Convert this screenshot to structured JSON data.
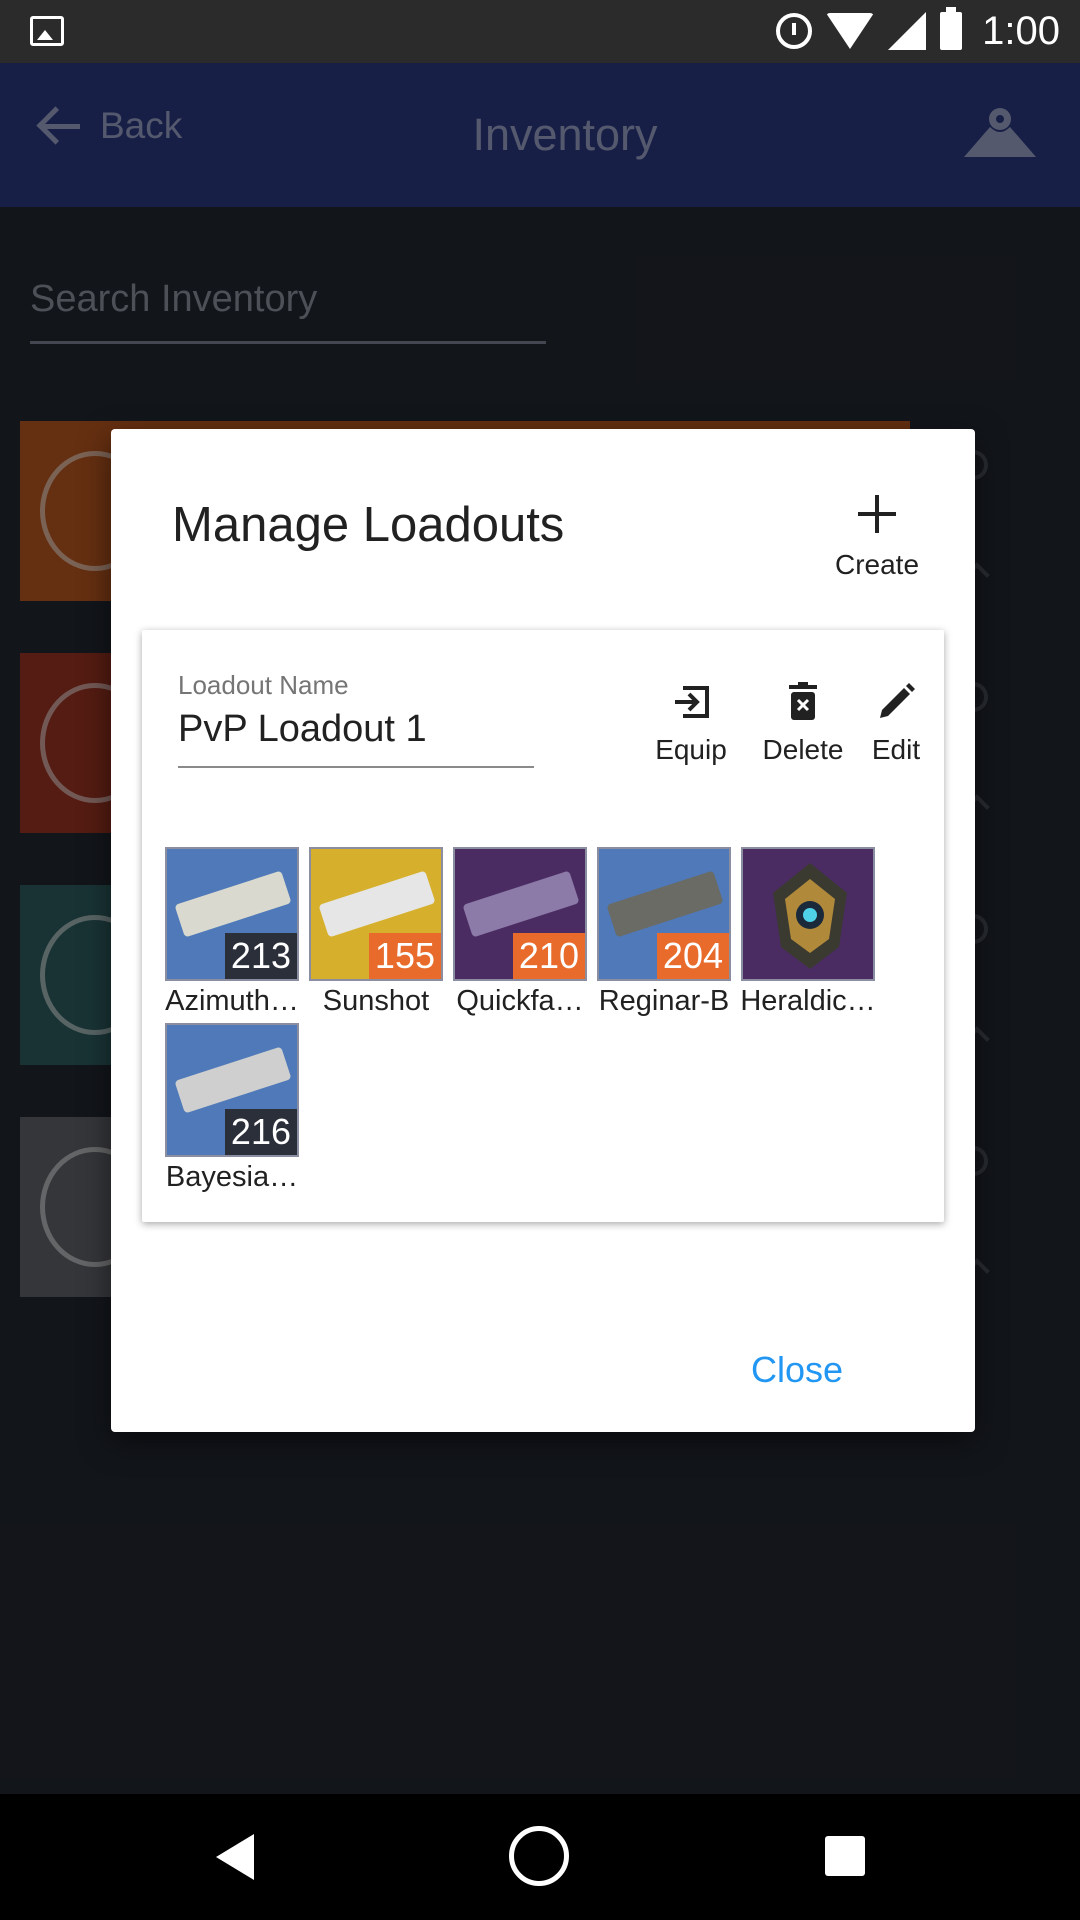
{
  "status_bar": {
    "time": "1:00"
  },
  "app_bar": {
    "back_label": "Back",
    "title": "Inventory"
  },
  "search": {
    "placeholder": "Search Inventory"
  },
  "dialog": {
    "title": "Manage Loadouts",
    "create_label": "Create",
    "close_label": "Close",
    "loadout": {
      "name_label": "Loadout Name",
      "name_value": "PvP Loadout 1",
      "actions": {
        "equip": "Equip",
        "delete": "Delete",
        "edit": "Edit"
      },
      "items": [
        {
          "name": "Azimuth…",
          "power": "213",
          "power_color": "#2b2f3a",
          "bg": "#4f79b8"
        },
        {
          "name": "Sunshot",
          "power": "155",
          "power_color": "#e86b2c",
          "bg": "#d6b02c"
        },
        {
          "name": "Quickfa…",
          "power": "210",
          "power_color": "#e86b2c",
          "bg": "#4a2c63"
        },
        {
          "name": "Reginar-B",
          "power": "204",
          "power_color": "#e86b2c",
          "bg": "#4f79b8"
        },
        {
          "name": "Heraldic…",
          "power": "",
          "power_color": "",
          "bg": "#4a2c63"
        },
        {
          "name": "Bayesia…",
          "power": "216",
          "power_color": "#2b2f3a",
          "bg": "#4f79b8"
        }
      ]
    }
  },
  "colors": {
    "app_bar": "#2b3a82",
    "background": "#222731",
    "accent": "#2196f3"
  }
}
